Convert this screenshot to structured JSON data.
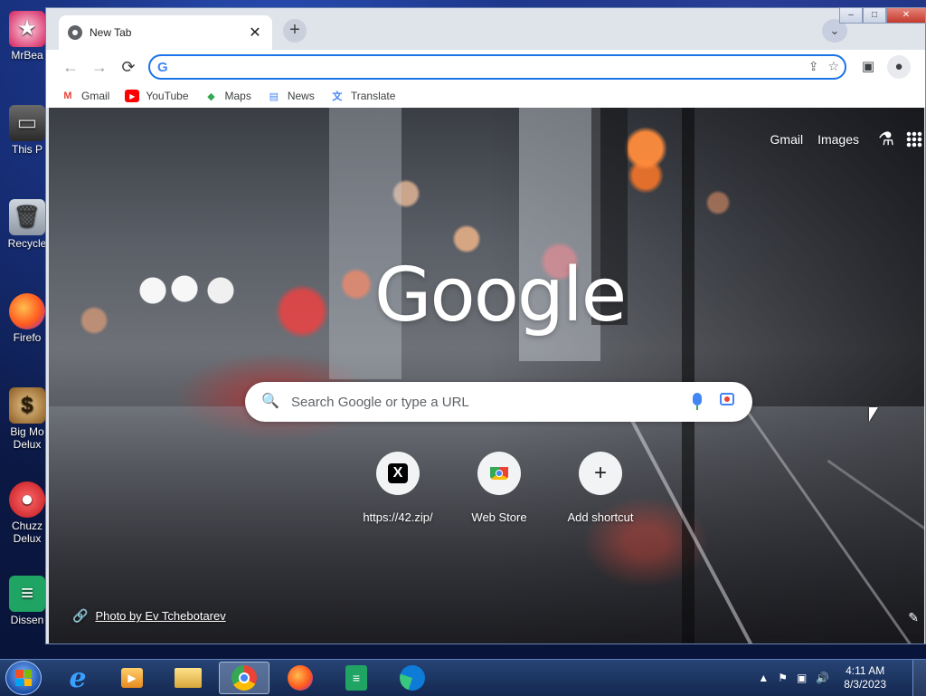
{
  "desktop": {
    "icons": [
      {
        "label": "MrBea",
        "icon": "mrbeast-app-icon"
      },
      {
        "label": "This P",
        "icon": "computer-icon"
      },
      {
        "label": "Recycle",
        "icon": "recycle-bin-icon"
      },
      {
        "label": "Firefo",
        "icon": "firefox-icon"
      },
      {
        "label": "Big Mo Delux",
        "icon": "money-bag-icon"
      },
      {
        "label": "Chuzz Delux",
        "icon": "chuzzle-icon"
      },
      {
        "label": "Dissen",
        "icon": "document-app-icon"
      }
    ]
  },
  "browser": {
    "tab": {
      "title": "New Tab",
      "close": "✕"
    },
    "new_tab": "+",
    "tab_search": "⌄",
    "window_controls": {
      "minimize": "–",
      "maximize": "□",
      "close": "✕"
    },
    "nav": {
      "back": "←",
      "forward": "→",
      "reload": "⟳"
    },
    "omnibox": {
      "value": "",
      "placeholder": "",
      "g_icon": "G"
    },
    "bookmarks": [
      {
        "label": "Gmail",
        "icon": "gmail-icon",
        "color": "#ea4335"
      },
      {
        "label": "YouTube",
        "icon": "youtube-icon",
        "color": "#ff0000"
      },
      {
        "label": "Maps",
        "icon": "maps-icon",
        "color": "#34a853"
      },
      {
        "label": "News",
        "icon": "news-icon",
        "color": "#4285f4"
      },
      {
        "label": "Translate",
        "icon": "translate-icon",
        "color": "#4285f4"
      }
    ]
  },
  "ntp": {
    "links": {
      "gmail": "Gmail",
      "images": "Images"
    },
    "logo": "Google",
    "search_placeholder": "Search Google or type a URL",
    "shortcuts": [
      {
        "label": "https://42.zip/",
        "icon": "x-icon"
      },
      {
        "label": "Web Store",
        "icon": "web-store-icon"
      },
      {
        "label": "Add shortcut",
        "icon": "plus-icon"
      }
    ],
    "credit": "Photo by Ev Tchebotarev"
  },
  "taskbar": {
    "apps": [
      {
        "name": "internet-explorer-icon"
      },
      {
        "name": "media-player-icon"
      },
      {
        "name": "file-explorer-icon"
      },
      {
        "name": "chrome-icon",
        "active": true
      },
      {
        "name": "firefox-icon"
      },
      {
        "name": "sheets-icon"
      },
      {
        "name": "edge-icon"
      }
    ],
    "time": "4:11 AM",
    "date": "8/3/2023"
  },
  "colors": {
    "accent": "#1a73e8",
    "google_blue": "#4285f4",
    "google_red": "#ea4335",
    "google_yellow": "#fbbc05",
    "google_green": "#34a853"
  }
}
